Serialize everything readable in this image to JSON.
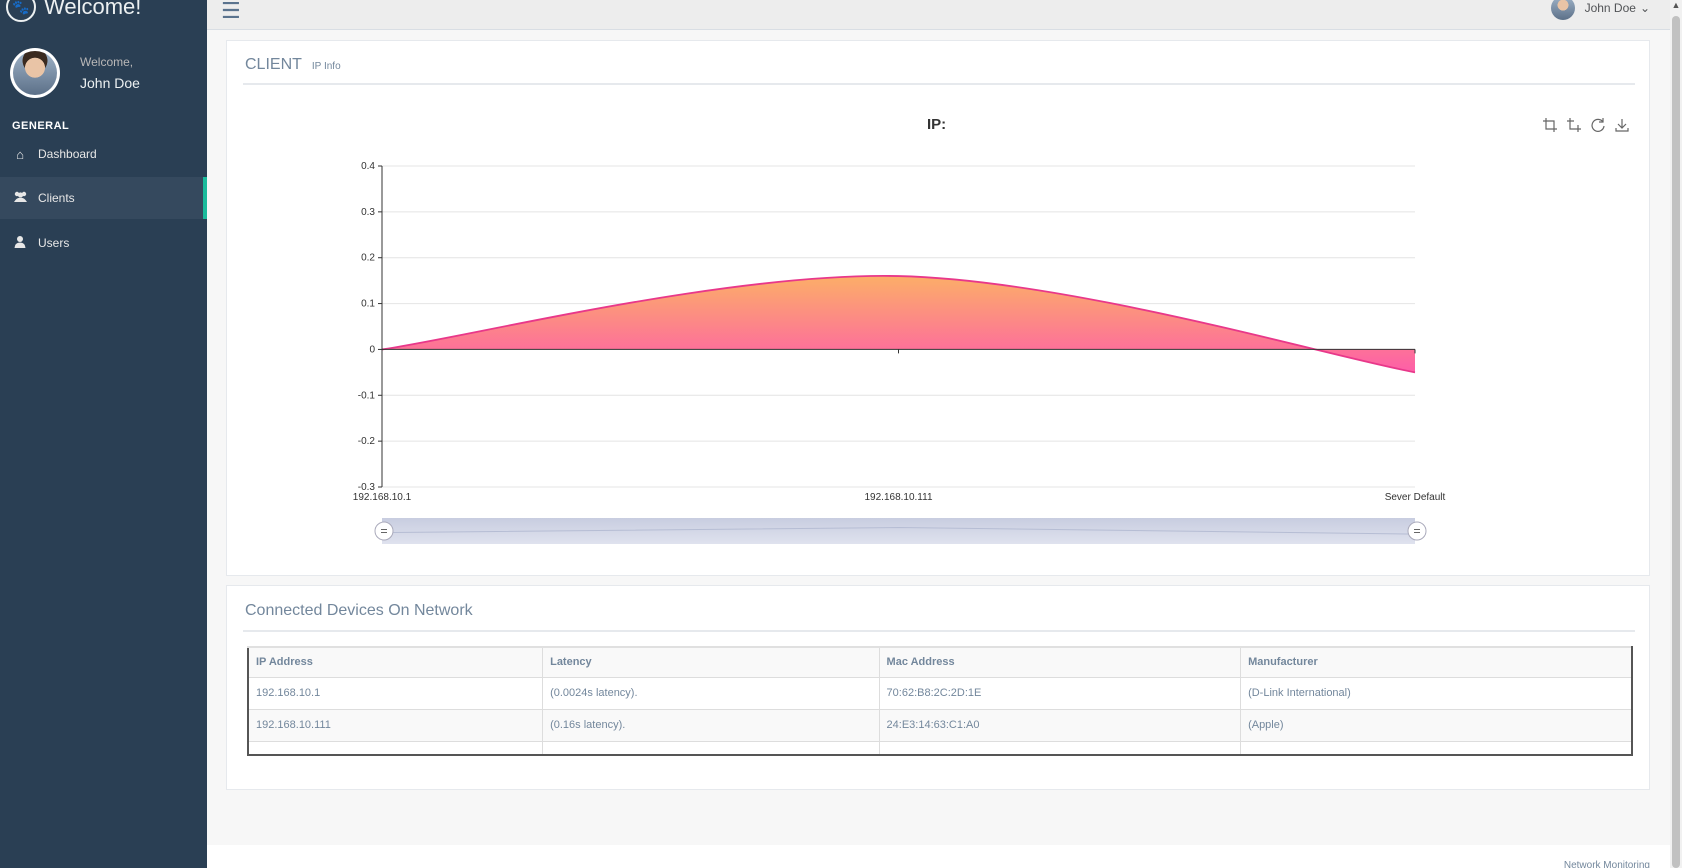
{
  "sidebar": {
    "brand": "Welcome!",
    "brand_icon": "paw-icon",
    "welcome": "Welcome,",
    "user_name": "John Doe",
    "section": "GENERAL",
    "items": [
      {
        "label": "Dashboard",
        "icon": "home-icon",
        "glyph": "⌂"
      },
      {
        "label": "Clients",
        "icon": "users-icon",
        "glyph": "👥"
      },
      {
        "label": "Users",
        "icon": "user-icon",
        "glyph": "👤"
      }
    ],
    "active_item": "Clients"
  },
  "topbar": {
    "user_name": "John Doe",
    "dropdown_glyph": "⌄"
  },
  "client_panel": {
    "title": "CLIENT",
    "subtitle": "IP Info",
    "toolbox": [
      "zoom-icon",
      "zoom-reset-icon",
      "restore-icon",
      "download-icon"
    ]
  },
  "chart_data": {
    "type": "area",
    "title": "IP:",
    "categories": [
      "192.168.10.1",
      "192.168.10.111",
      "Sever Default"
    ],
    "values": [
      0,
      0.16,
      -0.05
    ],
    "smooth": true,
    "ylim": [
      -0.3,
      0.4
    ],
    "yticks": [
      0.4,
      0.3,
      0.2,
      0.1,
      0,
      -0.1,
      -0.2,
      -0.3
    ],
    "ytick_labels": [
      "0.4",
      "0.3",
      "0.2",
      "0.1",
      "0",
      "-0.1",
      "-0.2",
      "-0.3"
    ],
    "grid": true,
    "series_color": "#e8388a",
    "fill_top": "#fcae68",
    "fill_bottom": "#fd5ea8",
    "data_zoom": true
  },
  "devices_panel": {
    "title": "Connected Devices On Network",
    "columns": [
      "IP Address",
      "Latency",
      "Mac Address",
      "Manufacturer"
    ],
    "rows": [
      [
        "192.168.10.1",
        "(0.0024s latency).",
        "70:62:B8:2C:2D:1E",
        "(D-Link International)"
      ],
      [
        "192.168.10.111",
        "(0.16s latency).",
        "24:E3:14:63:C1:A0",
        "(Apple)"
      ]
    ]
  },
  "footer": {
    "text": "Network Monitoring"
  }
}
